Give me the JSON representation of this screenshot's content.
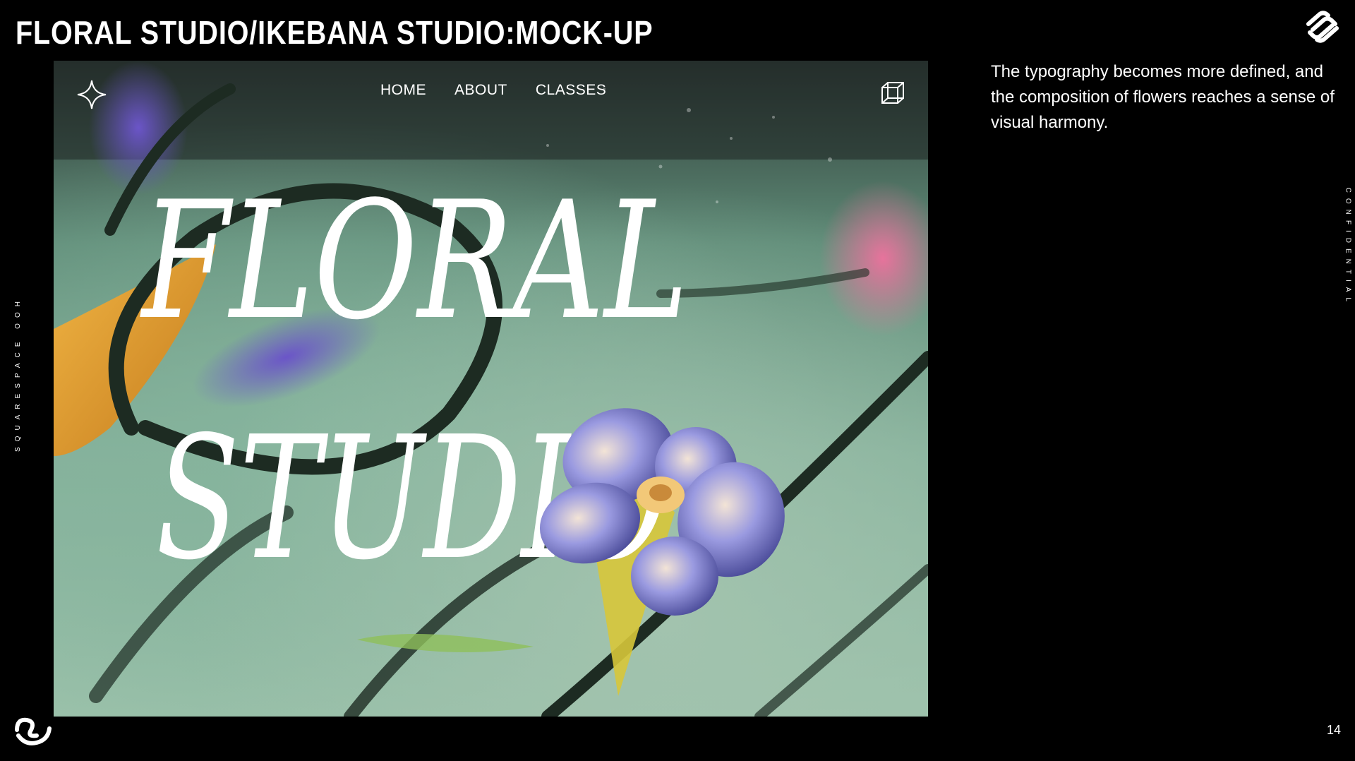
{
  "header": {
    "title": "FLORAL STUDIO/IKEBANA STUDIO:MOCK-UP"
  },
  "side": {
    "left_text": "SQUARESPACE OOH",
    "right_text": "CONFIDENTIAL"
  },
  "description": "The typography becomes more defined, and the composition of flowers reaches a sense of visual harmony.",
  "page_number": "14",
  "mockup": {
    "nav": {
      "items": [
        "HOME",
        "ABOUT",
        "CLASSES"
      ]
    },
    "hero": {
      "line1": "FLORAL",
      "line2": "STUDIO"
    },
    "icons": {
      "left": "sparkle-star-icon",
      "right": "cube-icon"
    }
  },
  "colors": {
    "background": "#000000",
    "text": "#ffffff",
    "mockup_green": "#84b09a",
    "orchid": "#6f73c4",
    "lily_orange": "#e2a63a"
  }
}
